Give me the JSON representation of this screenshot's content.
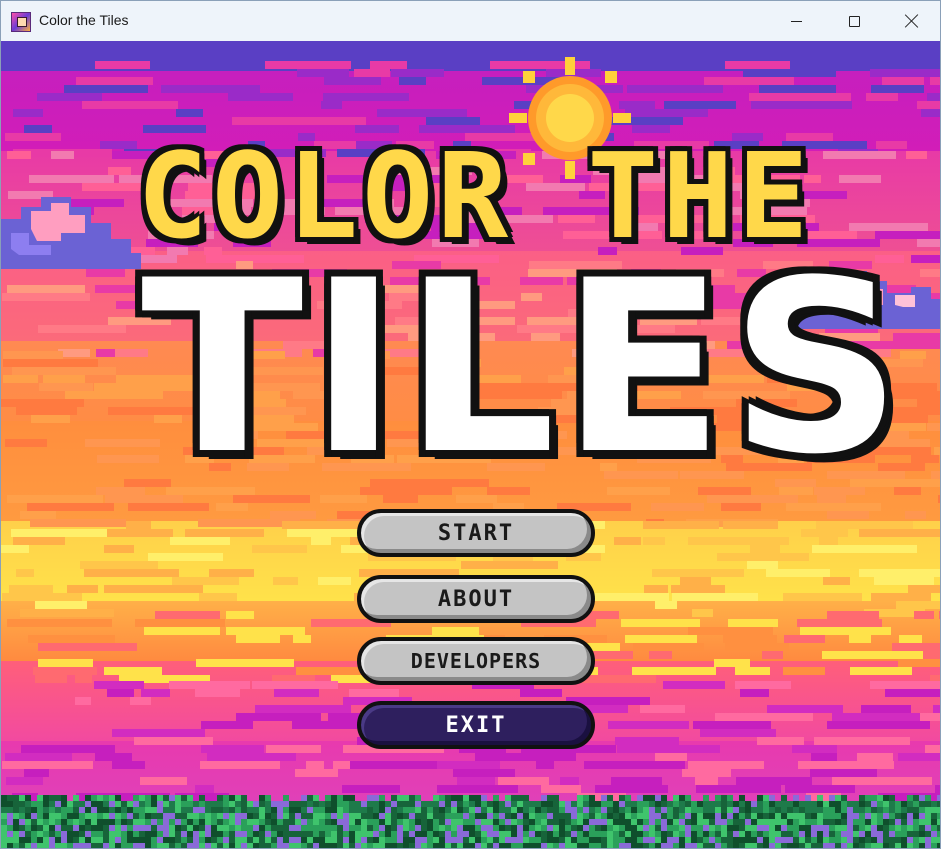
{
  "window": {
    "title": "Color the Tiles",
    "icon": "app-icon",
    "controls": [
      "minimize-icon",
      "maximize-icon",
      "close-icon"
    ]
  },
  "game": {
    "logo_line1": "COLOR THE",
    "logo_line2": "TILES",
    "colors": {
      "sky_top": "#5a3fc4",
      "sky_magenta": "#c61fbe",
      "pink": "#ee4f94",
      "orange": "#ff8c45",
      "yellow": "#ffe24a",
      "grass": "#1e7a4a",
      "logo_yellow": "#ffd84a",
      "button_gray": "#c4c4c4",
      "button_exit": "#2e1f5e"
    },
    "menu": {
      "start": "START",
      "about": "ABOUT",
      "developers": "DEVELOPERS",
      "exit": "EXIT"
    }
  }
}
